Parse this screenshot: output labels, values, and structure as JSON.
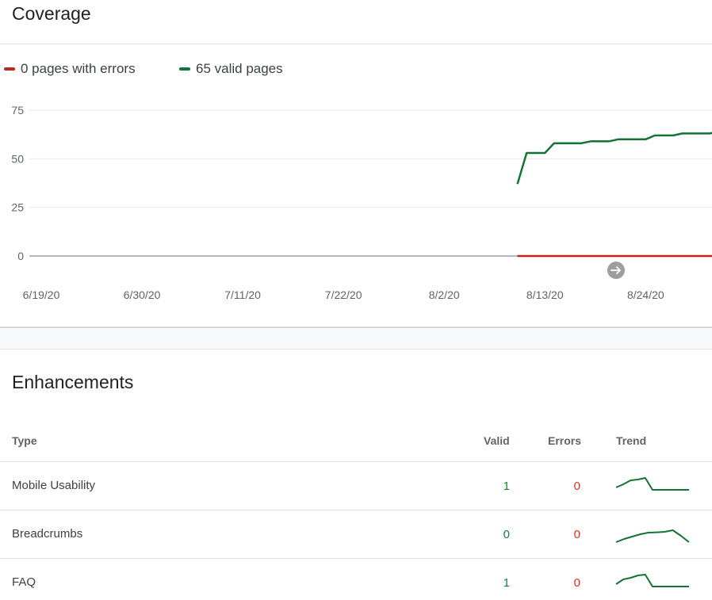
{
  "coverage": {
    "title": "Coverage",
    "legend": [
      {
        "label": "0 pages with errors",
        "color": "#c5221f"
      },
      {
        "label": "65 valid pages",
        "color": "#137333"
      }
    ],
    "next_icon": "arrow-right-icon"
  },
  "chart_data": {
    "type": "line",
    "x_tick_labels": [
      "6/19/20",
      "6/30/20",
      "7/11/20",
      "7/22/20",
      "8/2/20",
      "8/13/20",
      "8/24/20"
    ],
    "y_tick_labels": [
      "75",
      "50",
      "25",
      "0"
    ],
    "ylim": [
      0,
      75
    ],
    "xlim": [
      "2020-06-19",
      "2020-09-01"
    ],
    "grid": true,
    "legend_position": "top-left",
    "series": [
      {
        "name": "0 pages with errors",
        "color": "#c5221f",
        "points": [
          [
            "2020-08-10",
            0
          ],
          [
            "2020-09-01",
            0
          ]
        ]
      },
      {
        "name": "65 valid pages",
        "color": "#137333",
        "points": [
          [
            "2020-08-10",
            37
          ],
          [
            "2020-08-11",
            53
          ],
          [
            "2020-08-13",
            53
          ],
          [
            "2020-08-14",
            58
          ],
          [
            "2020-08-17",
            58
          ],
          [
            "2020-08-18",
            59
          ],
          [
            "2020-08-20",
            59
          ],
          [
            "2020-08-21",
            60
          ],
          [
            "2020-08-24",
            60
          ],
          [
            "2020-08-25",
            62
          ],
          [
            "2020-08-27",
            62
          ],
          [
            "2020-08-28",
            63
          ],
          [
            "2020-08-31",
            63
          ],
          [
            "2020-09-01",
            64
          ]
        ]
      }
    ]
  },
  "enhancements": {
    "title": "Enhancements",
    "columns": {
      "type": "Type",
      "valid": "Valid",
      "errors": "Errors",
      "trend": "Trend"
    },
    "rows": [
      {
        "type": "Mobile Usability",
        "valid": "1",
        "errors": "0",
        "trend": [
          0.4,
          0.6,
          0.85,
          0.9,
          1.0,
          0.25,
          0.25,
          0.25,
          0.25,
          0.25,
          0.25
        ]
      },
      {
        "type": "Breadcrumbs",
        "valid": "0",
        "errors": "0",
        "trend": [
          0.1,
          0.3,
          0.45,
          0.6,
          0.7,
          0.72,
          0.75,
          0.85,
          0.5,
          0.1
        ]
      },
      {
        "type": "FAQ",
        "valid": "1",
        "errors": "0",
        "trend": [
          0.4,
          0.7,
          0.8,
          0.95,
          1.0,
          0.25,
          0.25,
          0.25,
          0.25,
          0.25,
          0.25
        ]
      }
    ]
  }
}
